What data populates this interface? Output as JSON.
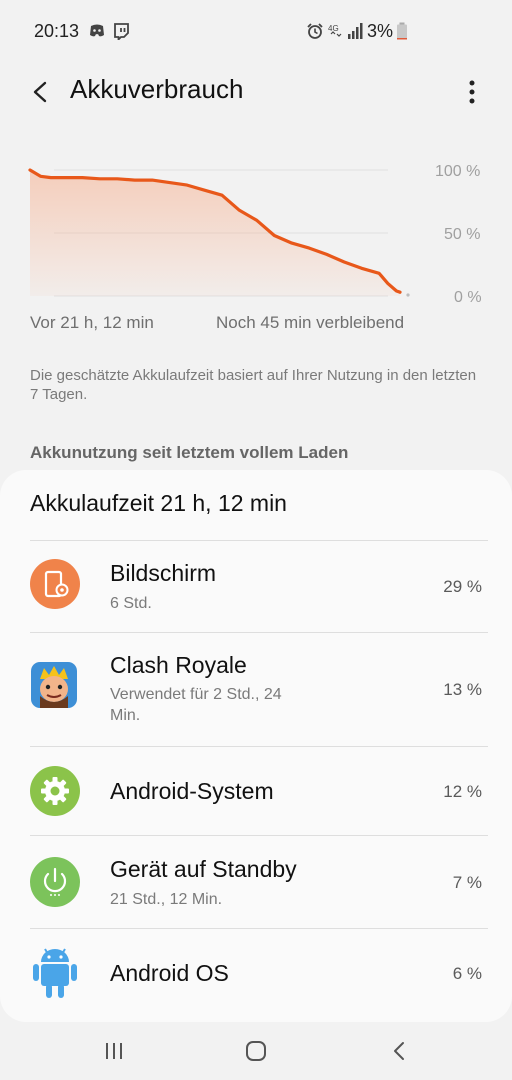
{
  "status": {
    "time": "20:13",
    "battery_percent": "3%",
    "network": "4G",
    "icons_left": [
      "discord-icon",
      "twitch-icon"
    ],
    "icons_right": [
      "alarm-icon",
      "4g-icon",
      "signal-icon",
      "battery-icon"
    ]
  },
  "app_bar": {
    "title": "Akkuverbrauch",
    "back_icon": "back-arrow-icon",
    "more_icon": "more-vertical-icon"
  },
  "chart": {
    "y_labels": [
      "100 %",
      "50 %",
      "0 %"
    ],
    "footer_left": "Vor 21 h, 12 min",
    "footer_right": "Noch 45 min verbleibend"
  },
  "chart_data": {
    "type": "area",
    "y_range": [
      0,
      100
    ],
    "line_color": "#e8581a",
    "series": [
      {
        "x_hours_since_charge": [
          0,
          0.6,
          1.2,
          3,
          4,
          5,
          6,
          7,
          8,
          9,
          10,
          11,
          12,
          13,
          14,
          15,
          16,
          17,
          18,
          19,
          20,
          20.5,
          21,
          21.2
        ],
        "battery_percent": [
          100,
          95,
          94,
          94,
          93,
          93,
          92,
          92,
          90,
          88,
          84,
          80,
          68,
          60,
          48,
          42,
          38,
          33,
          27,
          22,
          18,
          10,
          4,
          3
        ]
      }
    ]
  },
  "note": "Die geschätzte Akkulaufzeit basiert auf Ihrer Nutzung in den letzten 7 Tagen.",
  "section_title": "Akkunutzung seit letztem vollem Laden",
  "card": {
    "header": "Akkulaufzeit 21 h, 12 min",
    "items": [
      {
        "title": "Bildschirm",
        "subtitle": "6 Std.",
        "percent": "29 %",
        "icon": "screen-settings-icon",
        "color": "#f0834a"
      },
      {
        "title": "Clash Royale",
        "subtitle": "Verwendet für 2 Std., 24 Min.",
        "percent": "13 %",
        "icon": "clash-royale-icon",
        "color": "#f1a532"
      },
      {
        "title": "Android-System",
        "subtitle": "",
        "percent": "12 %",
        "icon": "gear-icon",
        "color": "#8bc34a"
      },
      {
        "title": "Gerät auf Standby",
        "subtitle": "21 Std., 12 Min.",
        "percent": "7 %",
        "icon": "power-icon",
        "color": "#7cc35b"
      },
      {
        "title": "Android OS",
        "subtitle": "",
        "percent": "6 %",
        "icon": "android-icon",
        "color": "#4aa5e8"
      }
    ]
  },
  "nav": {
    "recents": "recent-apps-icon",
    "home": "home-icon",
    "back": "back-icon"
  }
}
